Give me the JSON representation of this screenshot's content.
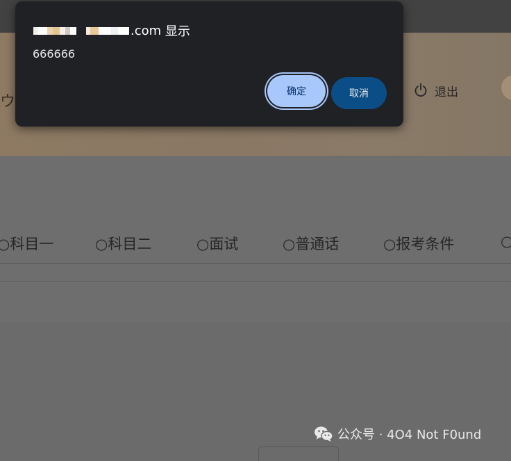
{
  "page": {
    "header_mark": "ウ",
    "logout": {
      "icon": "power-icon",
      "label": "退出"
    },
    "tabs": [
      {
        "label": "○科目一"
      },
      {
        "label": "○科目二"
      },
      {
        "label": "○面试"
      },
      {
        "label": "○普通话"
      },
      {
        "label": "○报考条件"
      },
      {
        "label": "○"
      }
    ]
  },
  "dialog": {
    "origin_suffix": ".com",
    "title_suffix": " 显示",
    "message": "666666",
    "ok_label": "确定",
    "cancel_label": "取消",
    "colors": {
      "ok_bg": "#a8c7fa",
      "cancel_bg": "#0b4d87",
      "dialog_bg": "#202124"
    }
  },
  "watermark": {
    "icon": "wechat-icon",
    "text": "公众号 · 4O4 Not F0und"
  }
}
